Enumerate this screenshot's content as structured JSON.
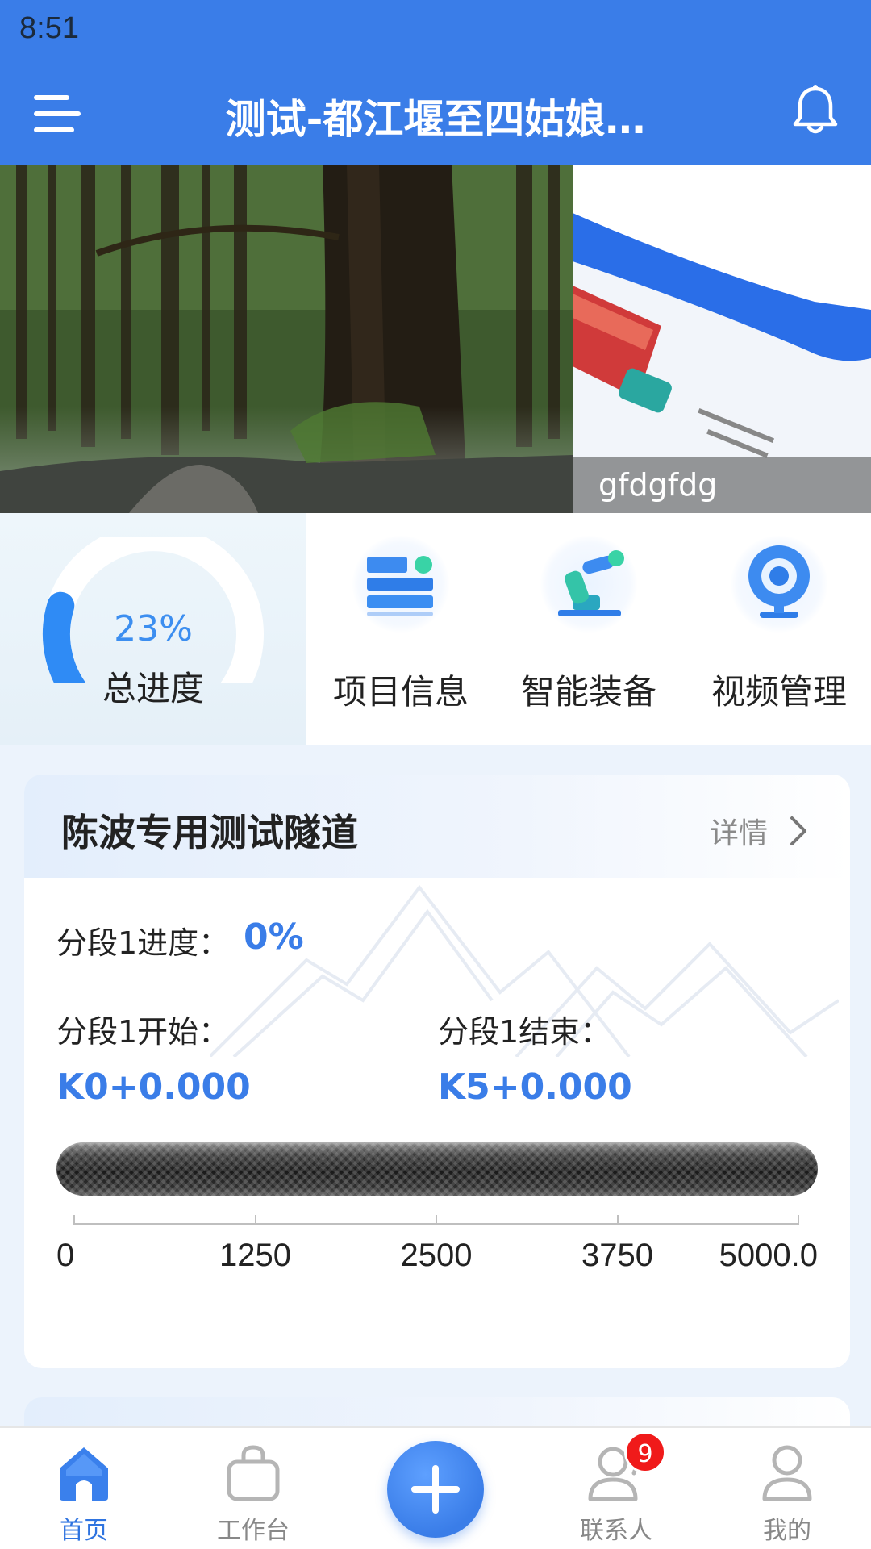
{
  "status": {
    "time": "8:51"
  },
  "header": {
    "title": "测试-都江堰至四姑娘…"
  },
  "banner": {
    "slides": [
      {
        "caption": ""
      },
      {
        "caption": "gfdgfdg"
      }
    ]
  },
  "quick": {
    "progress": {
      "value": 23,
      "percent_text": "23%",
      "label": "总进度"
    },
    "items": [
      {
        "label": "项目信息",
        "icon": "project-info-icon"
      },
      {
        "label": "智能装备",
        "icon": "robot-arm-icon"
      },
      {
        "label": "视频管理",
        "icon": "camera-icon"
      }
    ]
  },
  "tunnel_card": {
    "title": "陈波专用测试隧道",
    "detail_label": "详情",
    "segment_progress_label": "分段1进度：",
    "segment_progress_value": "0%",
    "start_label": "分段1开始：",
    "start_value": "K0+0.000",
    "end_label": "分段1结束：",
    "end_value": "K5+0.000",
    "progress_fraction": 0,
    "axis_labels": [
      "0",
      "1250",
      "2500",
      "3750",
      "5000.0"
    ]
  },
  "bottom_nav": {
    "items": [
      {
        "label": "首页",
        "active": true
      },
      {
        "label": "工作台",
        "active": false
      },
      {
        "label": "联系人",
        "active": false,
        "badge": "9"
      },
      {
        "label": "我的",
        "active": false
      }
    ]
  },
  "colors": {
    "primary": "#3a7de8",
    "badge": "#f01a1a"
  }
}
